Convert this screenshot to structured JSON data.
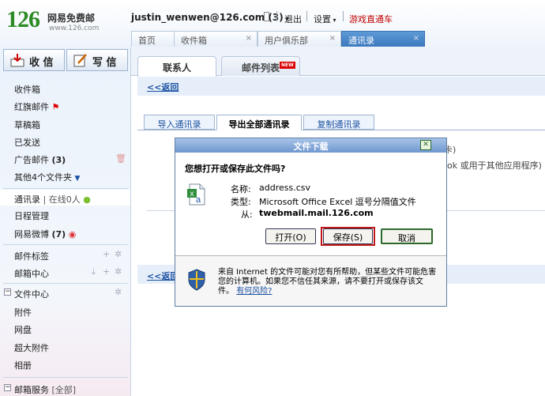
{
  "header": {
    "logo_number": "126",
    "logo_title": "网易免费邮",
    "logo_url": "www.126.com",
    "account": "justin_wenwen@126.com",
    "unread_count": "(3)",
    "logout": "退出",
    "settings": "设置",
    "game": "游戏直通车"
  },
  "tabs": [
    {
      "label": "首页"
    },
    {
      "label": "收件箱"
    },
    {
      "label": "用户俱乐部"
    },
    {
      "label": "通讯录"
    }
  ],
  "compose": {
    "receive": "收 信",
    "write": "写 信"
  },
  "sidebar": {
    "inbox": "收件箱",
    "flagged": "红旗邮件",
    "drafts": "草稿箱",
    "sent": "已发送",
    "ads": "广告邮件",
    "ads_count": "(3)",
    "other": "其他4个文件夹",
    "contacts": "通讯录",
    "online": "在线0人",
    "schedule": "日程管理",
    "weibo": "网易微博",
    "weibo_count": "(7)",
    "tags": "邮件标签",
    "mailcenter": "邮箱中心",
    "filecenter": "文件中心",
    "attach": "附件",
    "disk": "网盘",
    "bigattach": "超大附件",
    "album": "相册",
    "service": "邮箱服务",
    "service_all": "[全部]"
  },
  "main": {
    "tab_contacts": "联系人",
    "tab_lists": "邮件列表",
    "new_badge": "NEW",
    "back": "<<返回",
    "import": "导入通讯录",
    "export_all": "导出全部通讯录",
    "copy": "复制通讯录",
    "bg_text1": "卡)",
    "bg_text2": "ok 或用于其他应用程序)"
  },
  "dialog": {
    "title": "文件下载",
    "question": "您想打开或保存此文件吗?",
    "name_label": "名称:",
    "name_value": "address.csv",
    "type_label": "类型:",
    "type_value": "Microsoft Office Excel 逗号分隔值文件",
    "from_label": "从:",
    "from_value": "twebmail.mail.126.com",
    "open": "打开(O)",
    "save": "保存(S)",
    "cancel": "取消",
    "notice": "来自 Internet 的文件可能对您有所帮助，但某些文件可能危害您的计算机。如果您不信任其来源，请不要打开或保存该文件。",
    "risk_link": "有何风险?"
  }
}
